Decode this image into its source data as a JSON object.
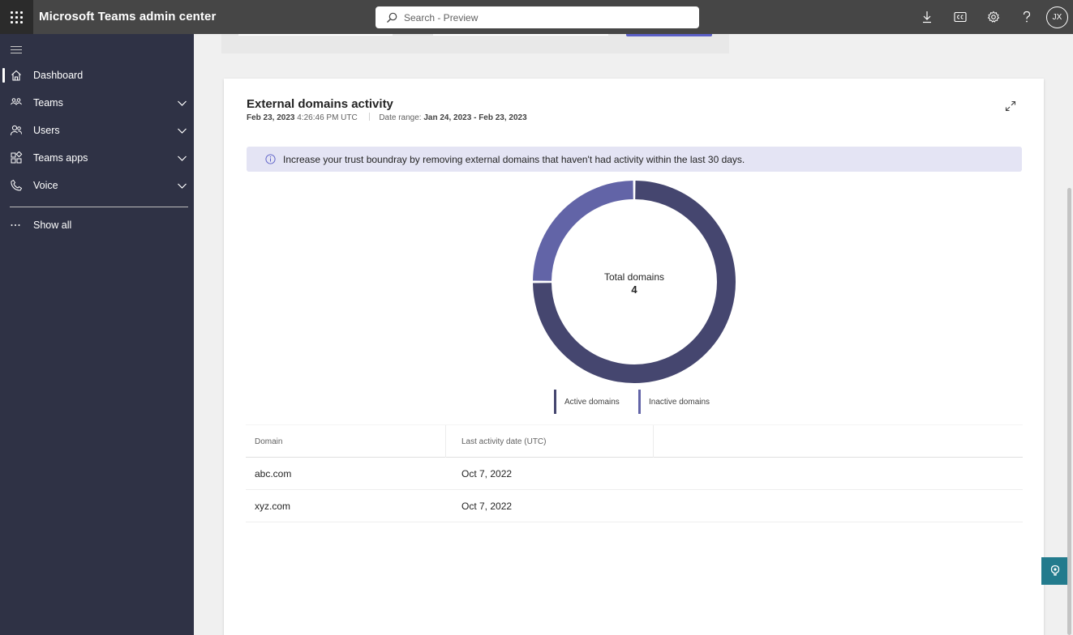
{
  "header": {
    "app_title": "Microsoft Teams admin center",
    "search_placeholder": "Search - Preview",
    "user_initials": "JX",
    "icons": [
      "download-icon",
      "cc-icon",
      "gear-icon",
      "help-icon"
    ]
  },
  "sidebar": {
    "items": [
      {
        "label": "Dashboard",
        "icon": "home-icon",
        "active": true
      },
      {
        "label": "Teams",
        "icon": "teams-icon",
        "expandable": true
      },
      {
        "label": "Users",
        "icon": "users-icon",
        "expandable": true
      },
      {
        "label": "Teams apps",
        "icon": "apps-icon",
        "expandable": true
      },
      {
        "label": "Voice",
        "icon": "phone-icon",
        "expandable": true
      }
    ],
    "show_all": "Show all"
  },
  "card": {
    "title": "External domains activity",
    "date": "Feb 23, 2023",
    "time": "4:26:46 PM UTC",
    "date_range_label": "Date range:",
    "date_range_start": "Jan 24, 2023",
    "date_range_sep": " - ",
    "date_range_end": "Feb 23, 2023",
    "banner_text": "Increase your trust boundray by removing external domains that haven't had activity within the last 30 days.",
    "donut": {
      "center_label": "Total domains",
      "center_value": "4",
      "segments": [
        {
          "name": "Active domains",
          "value": 3,
          "color": "#45466f"
        },
        {
          "name": "Inactive domains",
          "value": 1,
          "color": "#6264a7"
        }
      ]
    },
    "legend": [
      {
        "label": "Active domains",
        "color": "#45466f"
      },
      {
        "label": "Inactive domains",
        "color": "#6264a7"
      }
    ],
    "table": {
      "columns": [
        "Domain",
        "Last activity date (UTC)"
      ],
      "rows": [
        {
          "domain": "abc.com",
          "last_activity": "Oct 7, 2022"
        },
        {
          "domain": "xyz.com",
          "last_activity": "Oct 7, 2022"
        }
      ]
    }
  },
  "colors": {
    "topbar": "#464646",
    "sidebar": "#2f3245",
    "accent": "#5b5fc7",
    "banner": "#e4e4f4",
    "feedback": "#237b8d"
  }
}
